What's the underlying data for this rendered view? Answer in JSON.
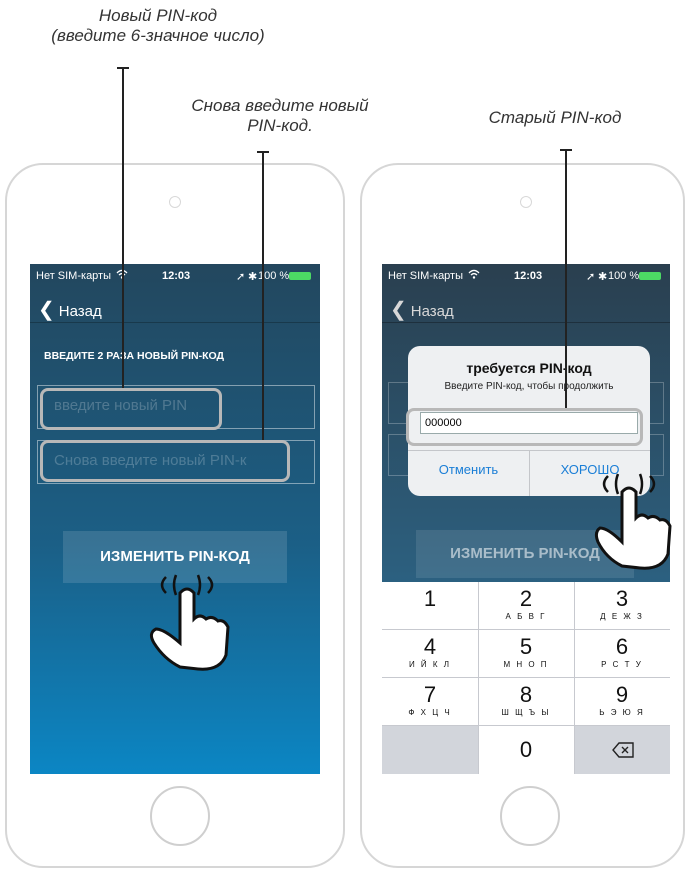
{
  "annotations": {
    "new_pin": "Новый PIN-код\n(введите 6-значное число)",
    "confirm_pin": "Снова введите новый\nPIN-код.",
    "old_pin": "Старый PIN-код"
  },
  "left_phone": {
    "status": {
      "carrier": "Нет SIM-карты",
      "time": "12:03",
      "battery": "100 %"
    },
    "back_label": "Назад",
    "section_title": "ВВЕДИТЕ 2 РАЗА НОВЫЙ PIN-КОД",
    "new_pin_placeholder": "введите новый PIN",
    "confirm_pin_placeholder": "Снова введите новый PIN-к",
    "change_button": "ИЗМЕНИТЬ PIN-КОД"
  },
  "right_phone": {
    "status": {
      "carrier": "Нет SIM-карты",
      "time": "12:03",
      "battery": "100 %"
    },
    "back_label": "Назад",
    "change_button": "ИЗМЕНИТЬ PIN-КОД",
    "dialog": {
      "title": "требуется PIN-код",
      "message": "Введите PIN-код, чтобы продолжить",
      "value": "000000",
      "cancel": "Отменить",
      "ok": "ХОРОШО"
    },
    "keypad": [
      {
        "num": "1",
        "letters": ""
      },
      {
        "num": "2",
        "letters": "А Б В Г"
      },
      {
        "num": "3",
        "letters": "Д Е Ж З"
      },
      {
        "num": "4",
        "letters": "И Й К Л"
      },
      {
        "num": "5",
        "letters": "М Н О П"
      },
      {
        "num": "6",
        "letters": "Р С Т У"
      },
      {
        "num": "7",
        "letters": "Ф Х Ц Ч"
      },
      {
        "num": "8",
        "letters": "Ш Щ Ъ Ы"
      },
      {
        "num": "9",
        "letters": "Ь Э Ю Я"
      },
      {
        "num": "0",
        "letters": ""
      }
    ],
    "backspace_icon": "backspace-icon"
  },
  "icons": [
    "wifi-icon",
    "bluetooth-icon",
    "location-icon",
    "battery-icon",
    "chevron-left-icon",
    "tap-hand-icon"
  ],
  "colors": {
    "screen_top": "#23475e",
    "screen_bottom": "#0b86c4",
    "keypad_bg": "#d2d5db",
    "accent": "#1a8cd8"
  }
}
